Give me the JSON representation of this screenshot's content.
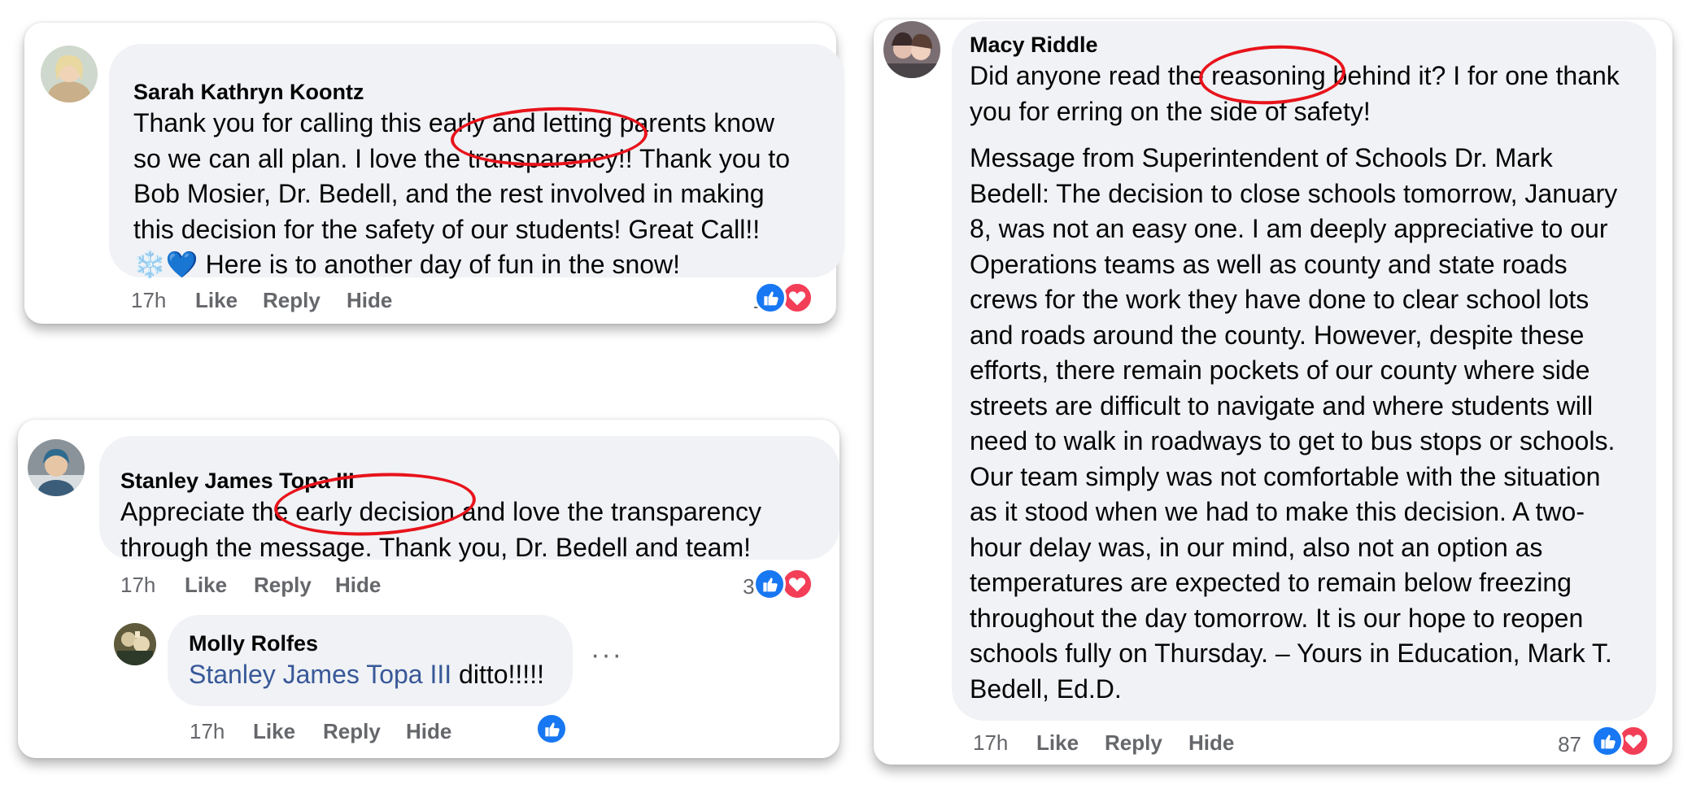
{
  "colors": {
    "bubble": "#f0f2f5",
    "meta_text": "#65676b",
    "mention": "#385898",
    "like": "#1877f2",
    "love": "#f33e58",
    "annotation": "#e8131b"
  },
  "comment1": {
    "author": "Sarah Kathryn Koontz",
    "lines": [
      "Thank you for calling this early and letting parents know",
      "so we can all plan. I love the transparency!! Thank you to",
      "Bob Mosier, Dr. Bedell, and the rest involved in making",
      "this decision for the safety of our students! Great Call!!"
    ],
    "emoji": "❄️💙",
    "last_line": " Here is to another day of fun in the snow!",
    "time": "17h",
    "like_label": "Like",
    "reply_label": "Reply",
    "hide_label": "Hide",
    "reaction_count": "15",
    "reactions": [
      "like-icon",
      "love-icon"
    ]
  },
  "comment2": {
    "author": "Stanley James Topa III",
    "lines": [
      "Appreciate the early decision and love the transparency",
      "through the message. Thank you, Dr. Bedell and team!"
    ],
    "time": "17h",
    "like_label": "Like",
    "reply_label": "Reply",
    "hide_label": "Hide",
    "reaction_count": "31",
    "reactions": [
      "like-icon",
      "love-icon"
    ],
    "reply": {
      "author": "Molly Rolfes",
      "mention": "Stanley James Topa III",
      "text": " ditto!!!!!",
      "more_label": "···",
      "time": "17h",
      "like_label": "Like",
      "reply_label": "Reply",
      "hide_label": "Hide",
      "reactions": [
        "like-icon"
      ]
    }
  },
  "comment3": {
    "author": "Macy Riddle",
    "lines": [
      "Did anyone read the reasoning behind it? I for one thank",
      "you for erring on the side of safety!"
    ],
    "quote_lines": [
      "Message from Superintendent of Schools Dr. Mark",
      "Bedell: The decision to close schools tomorrow, January",
      "8, was not an easy one. I am deeply appreciative to our",
      "Operations teams as well as county and state roads",
      "crews for the work they have done to clear school lots",
      "and roads around the county. However, despite these",
      "efforts, there remain pockets of our county where side",
      "streets are difficult to navigate and where students will",
      "need to walk in roadways to get to bus stops or schools.",
      "Our team simply was not comfortable with the situation",
      "as it stood when we had to make this decision. A two-",
      "hour delay was, in our mind, also not an option as",
      "temperatures are expected to remain below freezing",
      "throughout the day tomorrow. It is our hope to reopen",
      "schools fully on Thursday. – Yours in Education, Mark T.",
      "Bedell, Ed.D."
    ],
    "time": "17h",
    "like_label": "Like",
    "reply_label": "Reply",
    "hide_label": "Hide",
    "reaction_count": "87",
    "reactions": [
      "like-icon",
      "love-icon"
    ]
  }
}
